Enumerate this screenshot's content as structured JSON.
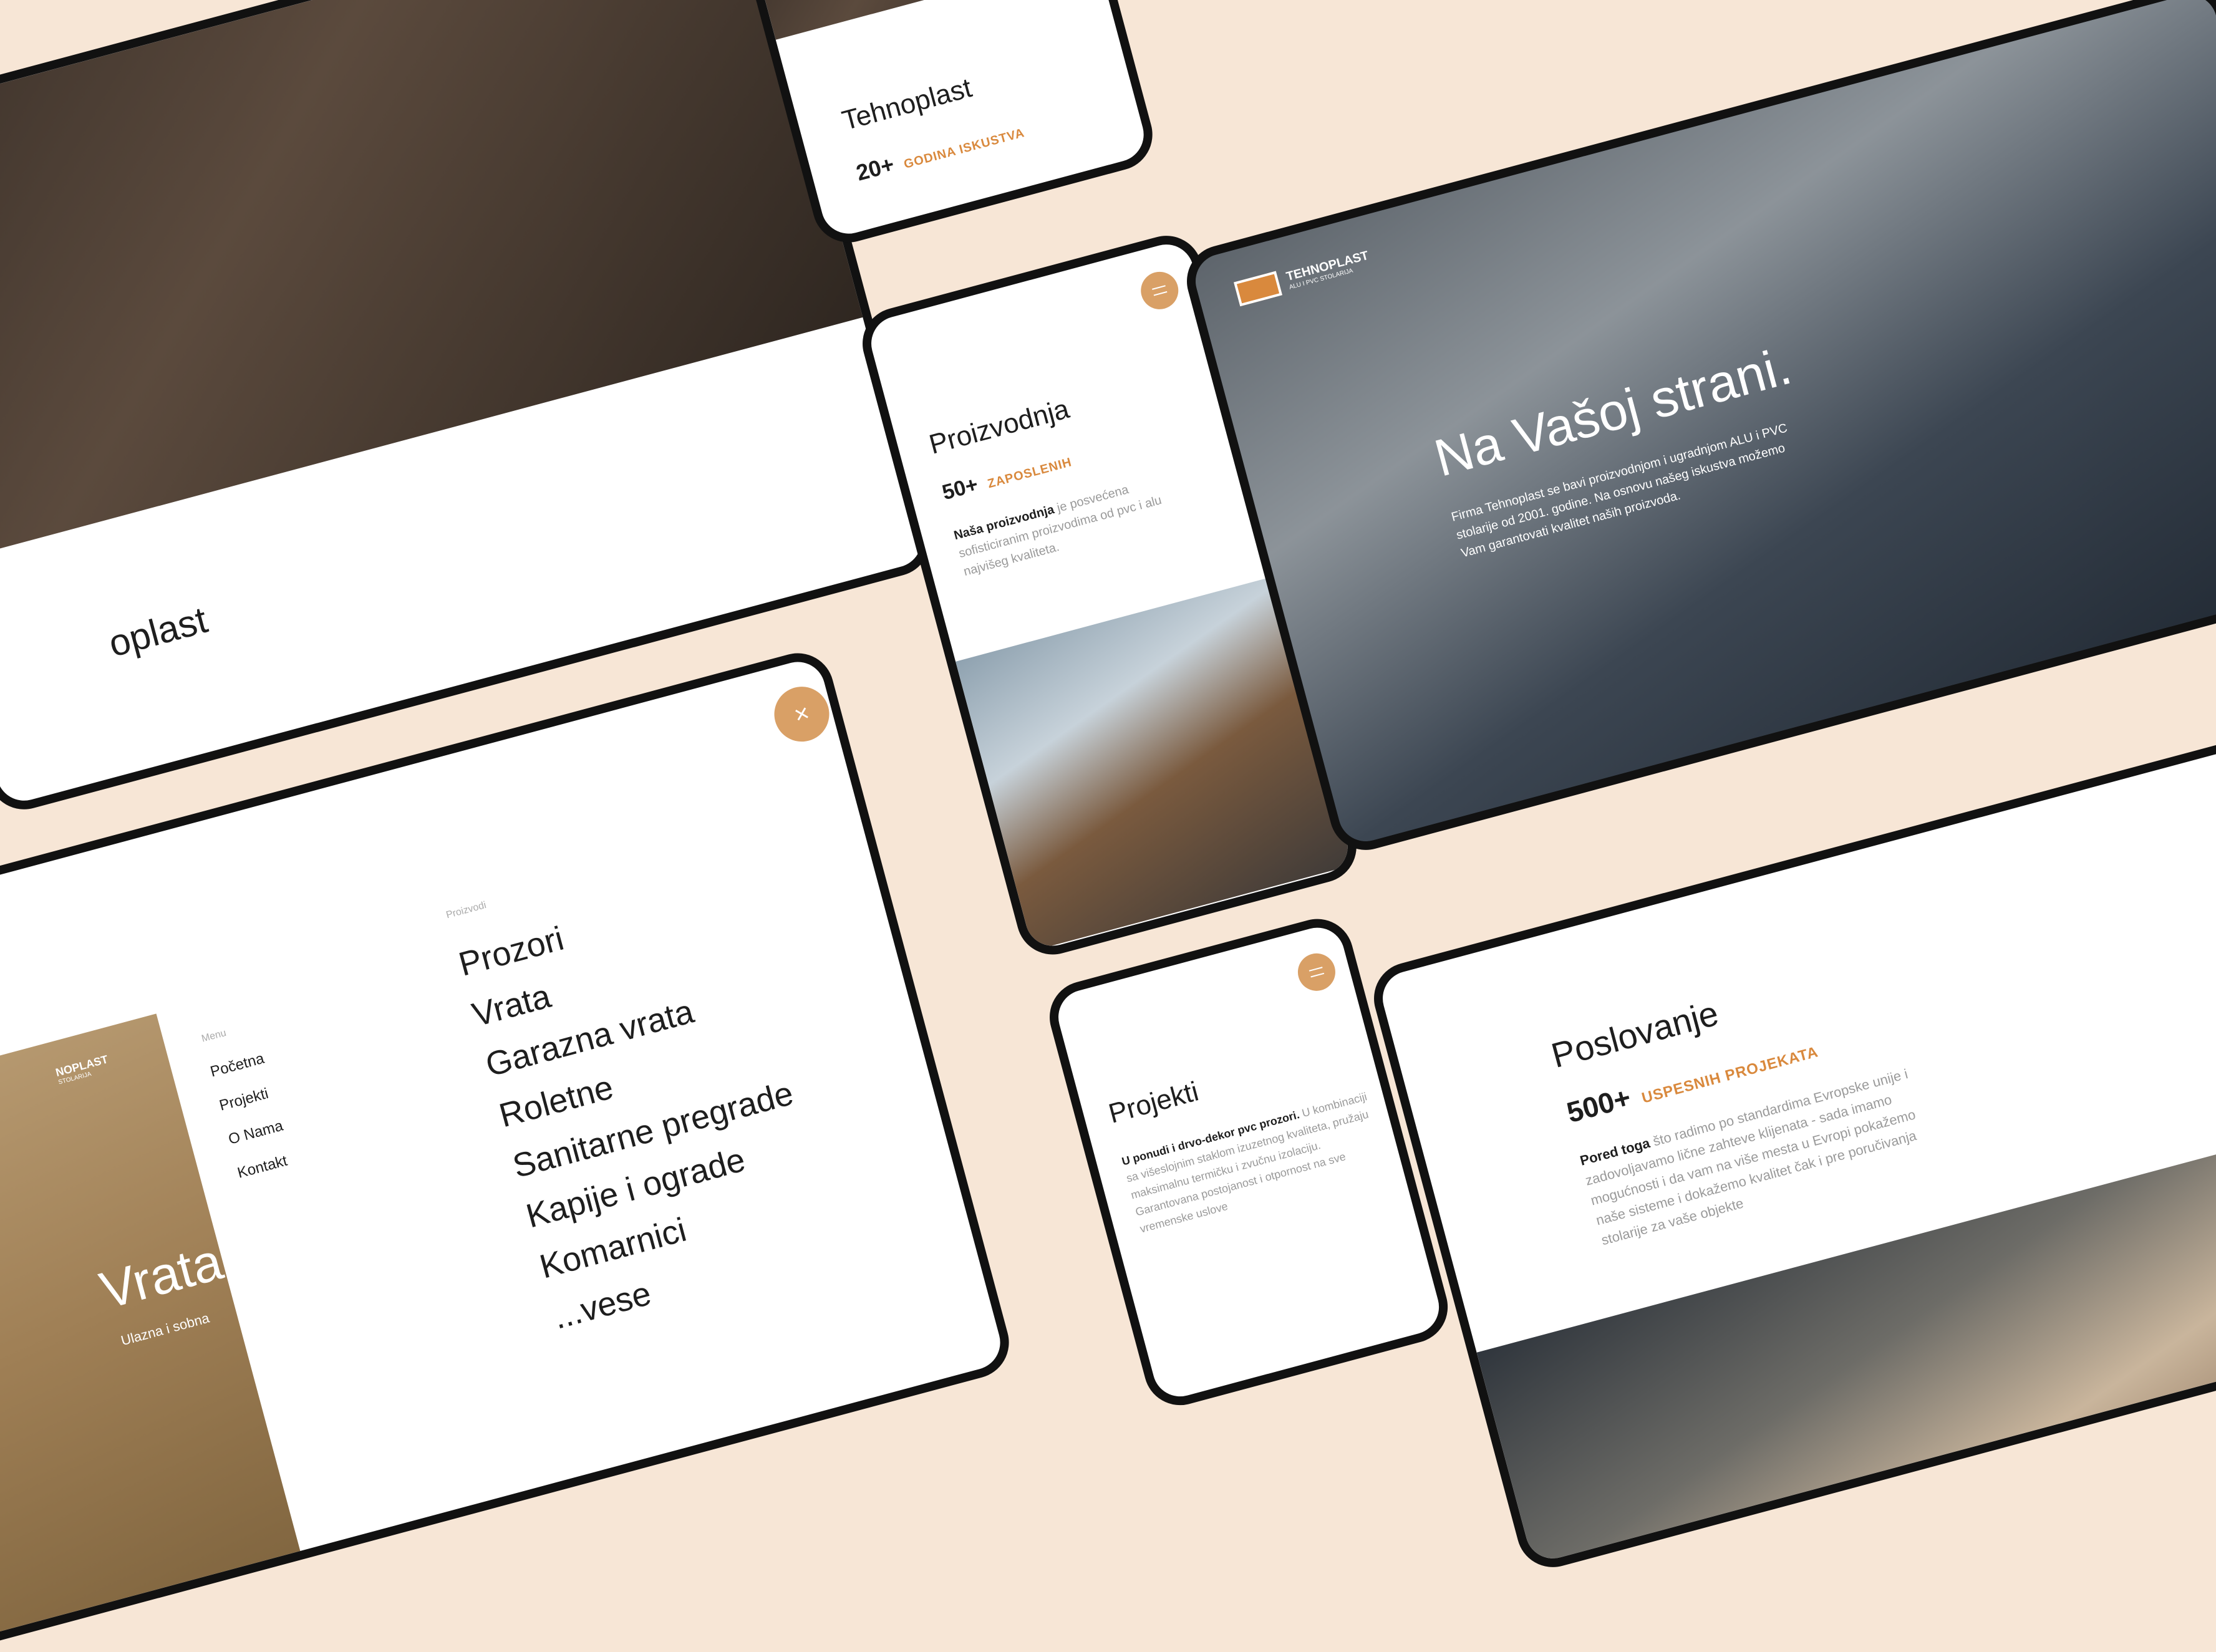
{
  "cards": {
    "topleft": {
      "title": "oplast"
    },
    "topmid": {
      "title": "Tehnoplast",
      "stat_number": "20+",
      "stat_label": "GODINA ISKUSTVA"
    },
    "proizvodnja": {
      "title": "Proizvodnja",
      "stat_number": "50+",
      "stat_label": "ZAPOSLENIH",
      "text_bold": "Naša proizvodnja",
      "text_rest": " je posvećena sofisticiranim proizvodima od pvc i alu najvišeg kvaliteta."
    },
    "hero": {
      "logo_name": "TEHNOPLAST",
      "logo_sub": "ALU I PVC STOLARIJA",
      "headline": "Na Vašoj strani.",
      "paragraph": "Firma Tehnoplast se bavi proizvodnjom i ugradnjom ALU i PVC stolarije od 2001. godine. Na osnovu našeg iskustva možemo Vam garantovati kvalitet naših proizvoda."
    },
    "menu": {
      "logo_name": "NOPLAST",
      "logo_sub": "STOLARIJA",
      "hero_title": "Vrata.",
      "hero_sub": "Ulazna i sobna",
      "menu_label": "Menu",
      "menu_items": [
        "Početna",
        "Projekti",
        "O Nama",
        "Kontakt"
      ],
      "products_label": "Proizvodi",
      "products": [
        "Prozori",
        "Vrata",
        "Garazna vrata",
        "Roletne",
        "Sanitarne pregrade",
        "Kapije i ograde",
        "Komarnici",
        "...vese"
      ]
    },
    "projekti": {
      "title": "Projekti",
      "text_bold": "U ponudi i drvo-dekor pvc prozori.",
      "text_rest": " U kombinaciji sa višeslojnim staklom izuzetnog kvaliteta, pružaju maksimalnu termičku i zvučnu izolaciju. Garantovana postojanost i otpornost na sve vremenske uslove"
    },
    "poslovanje": {
      "title": "Poslovanje",
      "stat_number": "500+",
      "stat_label": "USPESNIH PROJEKATA",
      "text_bold": "Pored toga",
      "text_rest": " što radimo po standardima Evropske unije i zadovoljavamo lične zahteve klijenata - sada imamo mogućnosti i da vam na više mesta u Evropi pokažemo naše sisteme i dokažemo kvalitet čak i pre poručivanja stolarije za vaše objekte"
    }
  },
  "icons": {
    "menu": "hamburger-icon",
    "close": "close-icon",
    "close_glyph": "×"
  },
  "colors": {
    "background": "#f7e6d6",
    "accent": "#d9a066",
    "accent_text": "#d9893d",
    "frame": "#111111"
  }
}
